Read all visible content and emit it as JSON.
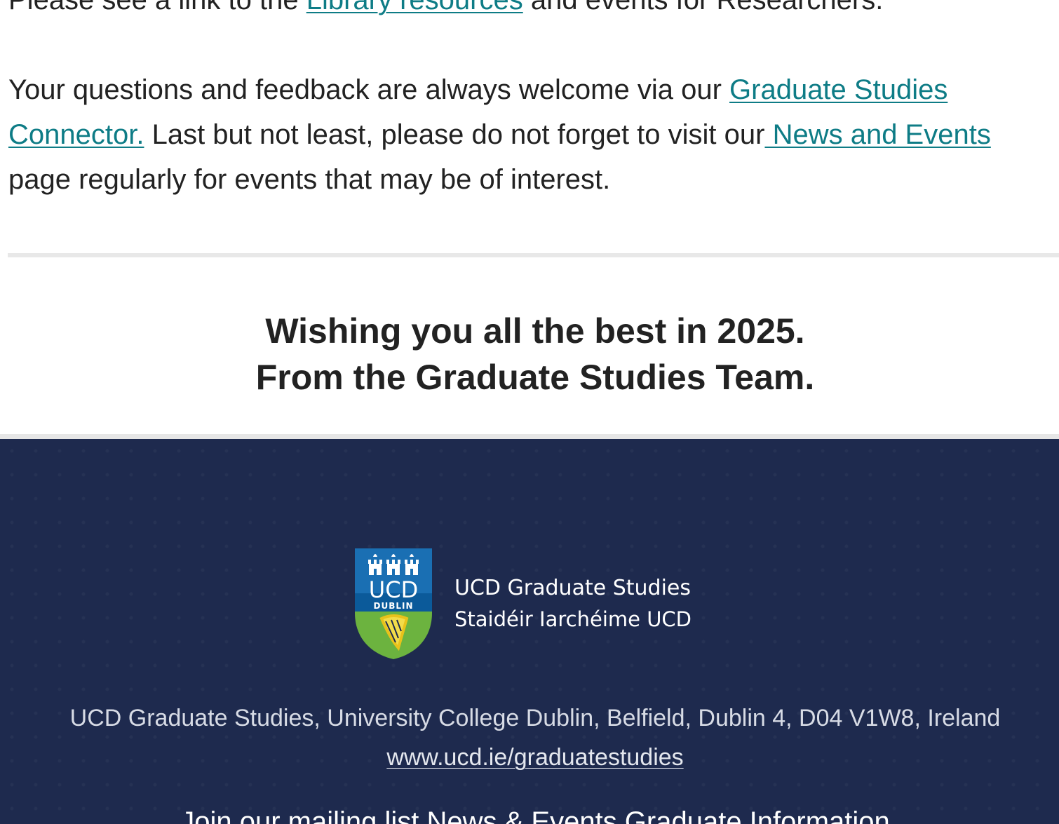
{
  "body": {
    "line0_pre": "Please see a link to the ",
    "line0_link": "Library resources",
    "line0_post": " and events for Researchers.",
    "line1_pre": "Your questions and feedback are always welcome via our ",
    "connector_link_part1": "Graduate Studies",
    "connector_link_part2": "Connector.",
    "line2_mid": " Last but not least, please do not forget to visit our",
    "news_link": " News and Events",
    "line3": "page regularly for events that may be of interest."
  },
  "closing": {
    "line1": "Wishing you all the best in 2025.",
    "line2": "From the Graduate Studies Team."
  },
  "footer": {
    "crest_ucd": "UCD",
    "crest_dublin": "DUBLIN",
    "brand_name": "UCD Graduate Studies",
    "brand_irish": "Staidéir Iarchéime UCD",
    "address": "UCD Graduate Studies, University College Dublin, Belfield, Dublin 4, D04 V1W8, Ireland",
    "website": "www.ucd.ie/graduatestudies",
    "bottom_partial": "Join our mailing list    News & Events    Graduate Information"
  },
  "colors": {
    "link": "#0e7c86",
    "footer_bg": "#1e2a4e",
    "crest_blue": "#1a6fb3",
    "crest_green": "#6cb33f",
    "harp_gold": "#e8c21b"
  }
}
